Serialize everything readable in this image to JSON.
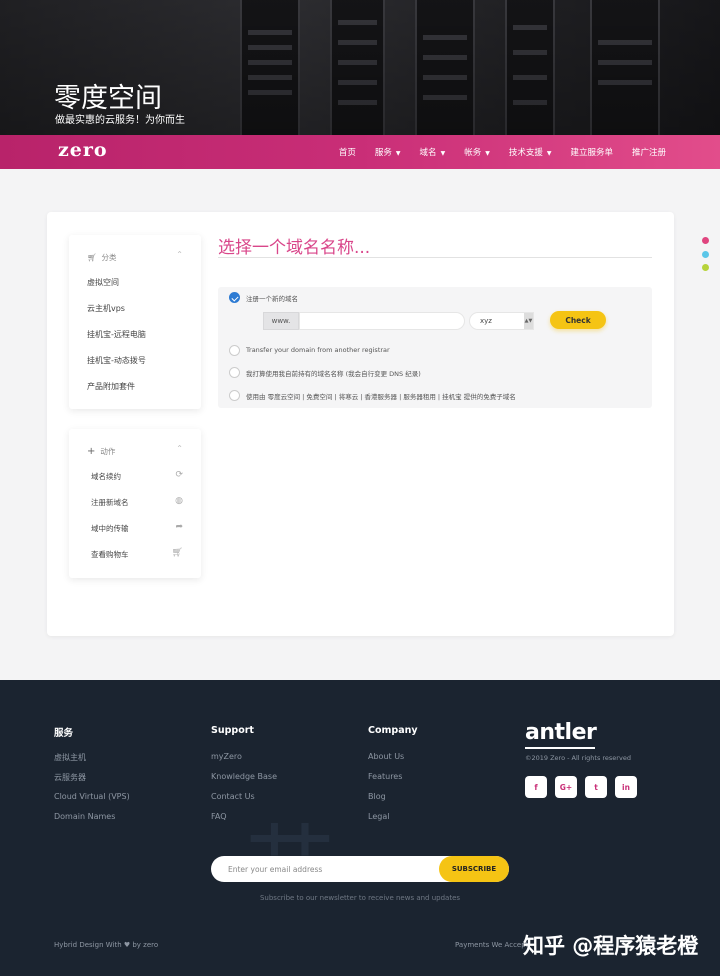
{
  "hero": {
    "title": "零度空间",
    "subtitle": "做最实惠的云服务！为你而生"
  },
  "nav": {
    "logo": "zero",
    "items": [
      {
        "label": "首页",
        "dropdown": false
      },
      {
        "label": "服务",
        "dropdown": true
      },
      {
        "label": "域名",
        "dropdown": true
      },
      {
        "label": "帐务",
        "dropdown": true
      },
      {
        "label": "技术支援",
        "dropdown": true
      },
      {
        "label": "建立服务单",
        "dropdown": false
      },
      {
        "label": "推广注册",
        "dropdown": false
      }
    ]
  },
  "categories": {
    "header": "分类",
    "items": [
      "虚拟空间",
      "云主机vps",
      "挂机宝-远程电脑",
      "挂机宝-动态拨号",
      "产品附加套件"
    ]
  },
  "actions": {
    "header": "动作",
    "items": [
      {
        "label": "域名续约",
        "icon": "refresh-icon"
      },
      {
        "label": "注册新域名",
        "icon": "globe-icon"
      },
      {
        "label": "域中的传输",
        "icon": "share-icon"
      },
      {
        "label": "查看购物车",
        "icon": "cart-icon"
      }
    ]
  },
  "domain": {
    "title": "选择一个域名名称...",
    "options": [
      "注册一个新的域名",
      "Transfer your domain from another registrar",
      "我打算使用我自前持有的域名名称 (我会自行变更 DNS 纪录)",
      "使用由 零度云空间 | 免费空间 | 将寒云 | 香港服务器 | 服务器租用 | 挂机宝 提供的免费子域名"
    ],
    "www_prefix": "www.",
    "tld": "xyz",
    "check_label": "Check"
  },
  "side_dots": [
    "#e0457f",
    "#5bc6e8",
    "#b7d33b"
  ],
  "footer": {
    "columns": [
      {
        "title": "服务",
        "links": [
          "虚拟主机",
          "云服务器",
          "Cloud Virtual (VPS)",
          "Domain Names"
        ]
      },
      {
        "title": "Support",
        "links": [
          "myZero",
          "Knowledge Base",
          "Contact Us",
          "FAQ"
        ]
      },
      {
        "title": "Company",
        "links": [
          "About Us",
          "Features",
          "Blog",
          "Legal"
        ]
      }
    ],
    "brand": "antler",
    "copyright": "©2019 Zero - All rights reserved",
    "social": [
      "f",
      "G+",
      "t",
      "in"
    ],
    "email_placeholder": "Enter your email address",
    "subscribe_label": "SUBSCRIBE",
    "newsletter_note": "Subscribe to our newsletter to receive news and updates",
    "bottom_left": "Hybrid Design With ♥ by zero",
    "bottom_right": "Payments We Accept",
    "watermark": "知乎 @程序猿老橙"
  }
}
